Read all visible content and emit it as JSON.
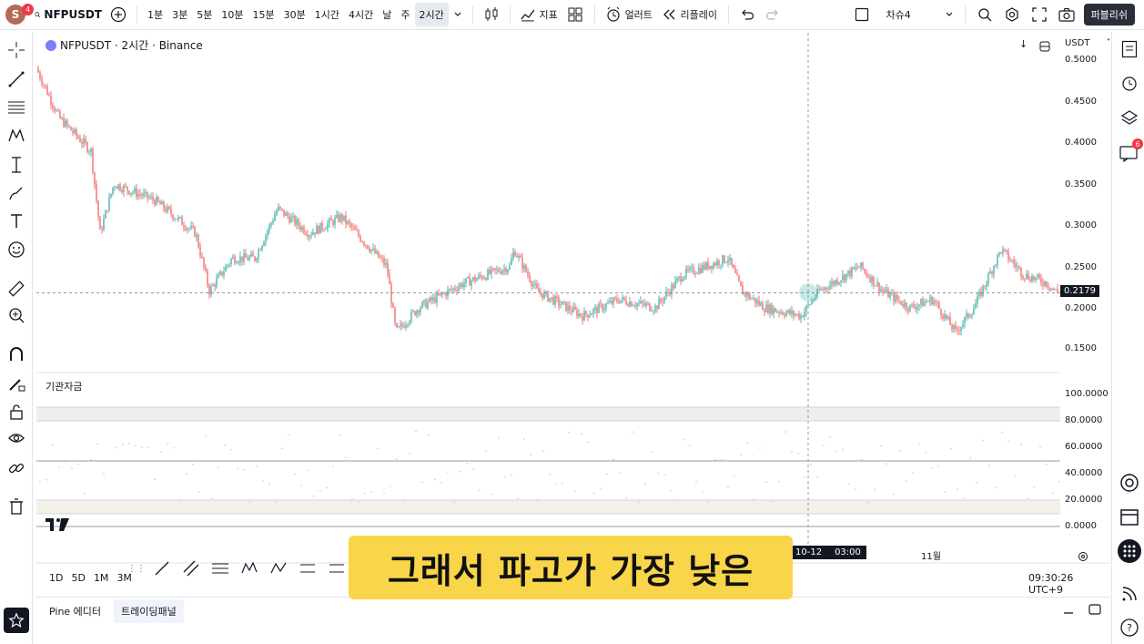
{
  "topbar": {
    "avatar_letter": "S",
    "avatar_badge": "4",
    "symbol": "NFPUSDT",
    "intervals": [
      "1분",
      "3분",
      "5분",
      "10분",
      "15분",
      "30분",
      "1시간",
      "4시간",
      "날",
      "주",
      "2시간"
    ],
    "indicators_label": "지표",
    "alert_label": "얼러트",
    "replay_label": "리플레이",
    "layout_name": "차슈4",
    "publish_label": "퍼블리쉬"
  },
  "chart": {
    "title": "NFPUSDT · 2시간 · Binance",
    "currency": "USDT",
    "price_ticks": [
      "0.5000",
      "0.4500",
      "0.4000",
      "0.3500",
      "0.3000",
      "0.2500",
      "0.2000",
      "0.1500"
    ],
    "last_price": "0.2179",
    "indicator_name": "기관자금",
    "osc_ticks": [
      "100.0000",
      "80.0000",
      "60.0000",
      "40.0000",
      "20.0000",
      "0.0000"
    ],
    "time_labels": [
      "10-12",
      "03:00",
      "11월"
    ],
    "clock": "09:30:26 UTC+9",
    "ranges": [
      "1D",
      "5D",
      "1M",
      "3M"
    ]
  },
  "rightbar": {
    "chat_badge": "6"
  },
  "bottom": {
    "pine_label": "Pine 에디터",
    "panel_label": "트레이딩패널"
  },
  "subtitle": "그래서 파고가 가장 낮은",
  "colors": {
    "up": "#26a69a",
    "down": "#ef5350",
    "accent": "#2962ff",
    "subtitle_bg": "#f9d54a"
  }
}
